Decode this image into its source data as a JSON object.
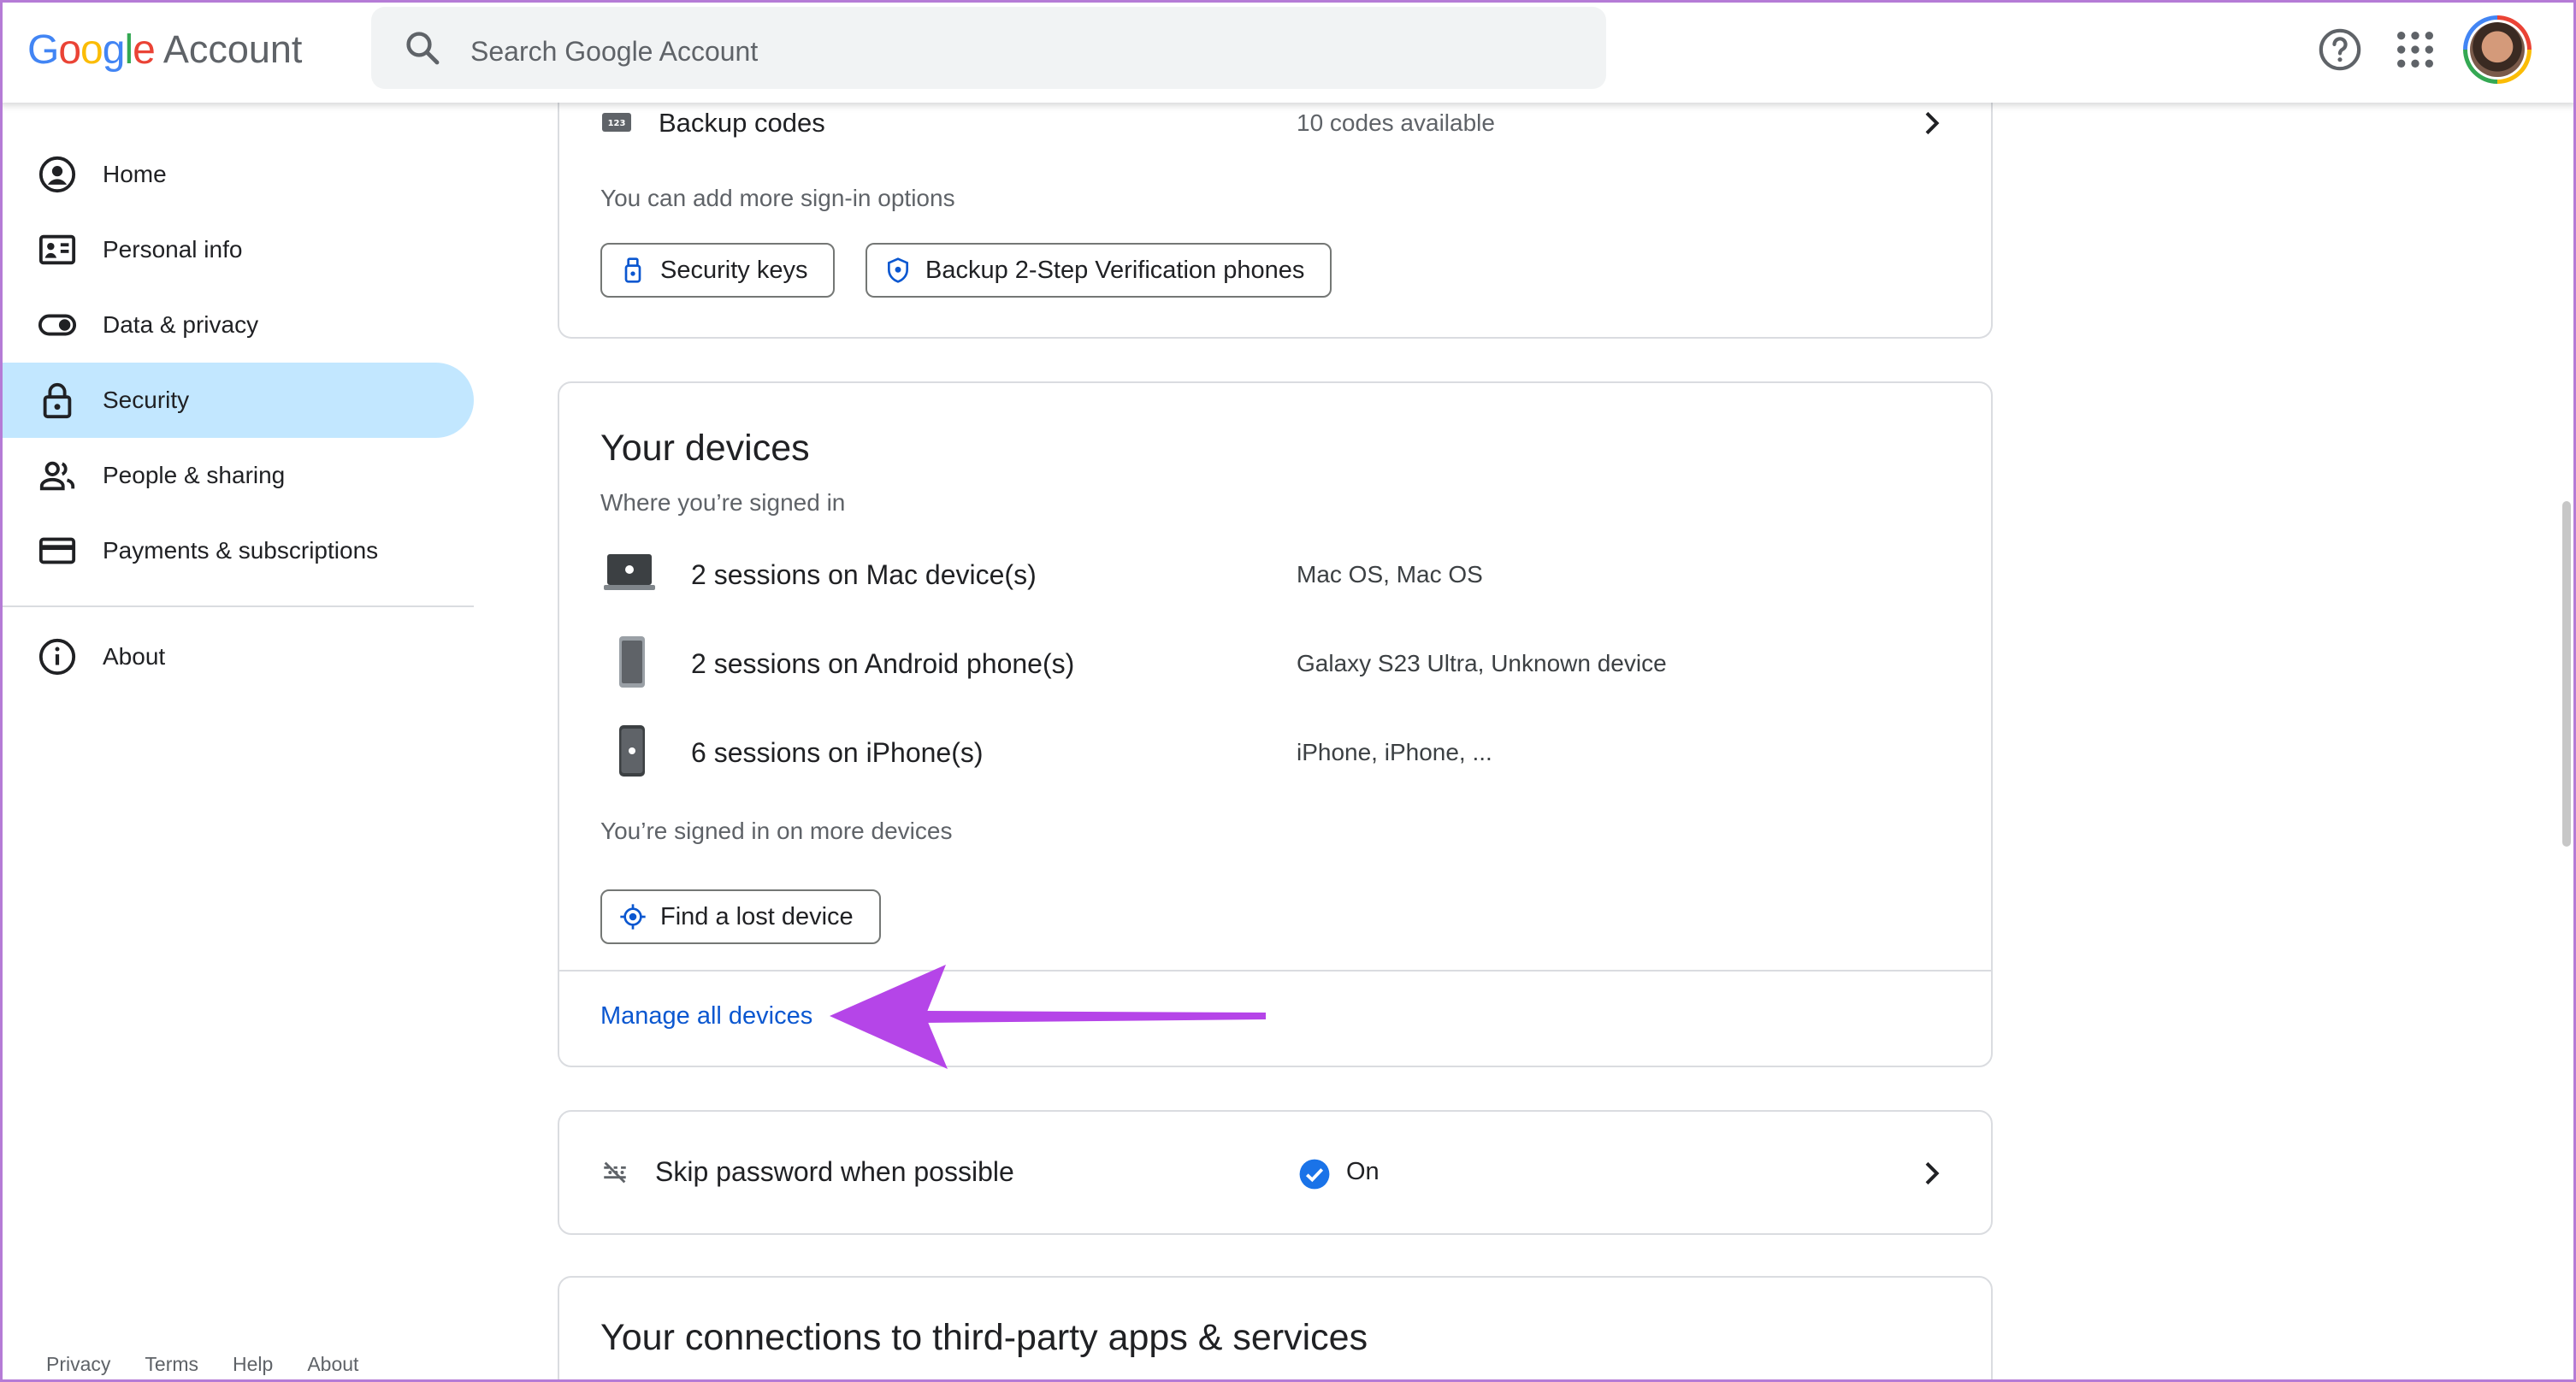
{
  "header": {
    "logo_letters": [
      "G",
      "o",
      "o",
      "g",
      "l",
      "e"
    ],
    "logo_colors": [
      "#4285f4",
      "#ea4335",
      "#fbbc05",
      "#4285f4",
      "#34a853",
      "#ea4335"
    ],
    "logo_suffix": "Account",
    "search_placeholder": "Search Google Account",
    "icons": [
      "help-icon",
      "apps-icon",
      "avatar"
    ]
  },
  "sidebar": {
    "items": [
      {
        "label": "Home",
        "icon": "home-icon"
      },
      {
        "label": "Personal info",
        "icon": "personal-info-icon"
      },
      {
        "label": "Data & privacy",
        "icon": "toggle-icon"
      },
      {
        "label": "Security",
        "icon": "lock-icon",
        "active": true
      },
      {
        "label": "People & sharing",
        "icon": "people-icon"
      },
      {
        "label": "Payments & subscriptions",
        "icon": "card-icon"
      }
    ],
    "about": {
      "label": "About",
      "icon": "info-icon"
    },
    "active_color": "#c2e7ff"
  },
  "footer": {
    "links": [
      "Privacy",
      "Terms",
      "Help",
      "About"
    ]
  },
  "signin_card": {
    "backup_codes": {
      "label": "Backup codes",
      "value": "10 codes available"
    },
    "more_options_text": "You can add more sign-in options",
    "chips": [
      "Security keys",
      "Backup 2-Step Verification phones"
    ]
  },
  "devices_card": {
    "title": "Your devices",
    "subtitle": "Where you’re signed in",
    "sessions": [
      {
        "label": "2 sessions on Mac device(s)",
        "detail": "Mac OS, Mac OS",
        "icon": "mac-laptop-icon"
      },
      {
        "label": "2 sessions on Android phone(s)",
        "detail": "Galaxy S23 Ultra, Unknown device",
        "icon": "android-phone-icon"
      },
      {
        "label": "6 sessions on iPhone(s)",
        "detail": "iPhone, iPhone, ...",
        "icon": "iphone-icon"
      }
    ],
    "more_devices_text": "You’re signed in on more devices",
    "find_button": "Find a lost device",
    "manage_link": "Manage all devices",
    "annotation_color": "#b545e8"
  },
  "skip_password_card": {
    "label": "Skip password when possible",
    "status": "On",
    "status_color": "#1a73e8"
  },
  "third_party_card": {
    "title": "Your connections to third-party apps & services"
  },
  "colors": {
    "link": "#0b57d0",
    "border": "#dadce0"
  }
}
